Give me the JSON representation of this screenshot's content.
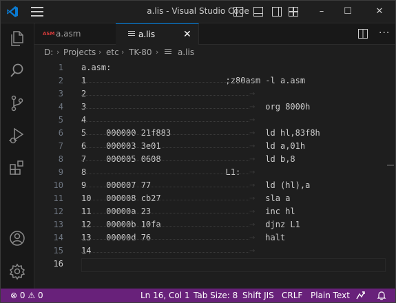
{
  "window": {
    "title": "a.lis - Visual Studio Code",
    "buttons": {
      "minimize": "–",
      "maximize": "☐",
      "close": "✕"
    }
  },
  "tabs": [
    {
      "badge": "ASM",
      "label": "a.asm",
      "active": false
    },
    {
      "label": "a.lis",
      "active": true,
      "close": "✕"
    }
  ],
  "tab_actions": {
    "more": "···"
  },
  "breadcrumb": [
    "D:",
    "Projects",
    "etc",
    "TK-80",
    "a.lis"
  ],
  "editor": {
    "lines": [
      {
        "n": "1",
        "text": "a.asm:"
      },
      {
        "n": "2",
        "text": "1                            ;z80asm -l a.asm"
      },
      {
        "n": "3",
        "text": "2"
      },
      {
        "n": "4",
        "text": "3                                    org 8000h"
      },
      {
        "n": "5",
        "text": "4"
      },
      {
        "n": "6",
        "text": "5    000000 21f883                   ld hl,83f8h"
      },
      {
        "n": "7",
        "text": "6    000003 3e01                     ld a,01h"
      },
      {
        "n": "8",
        "text": "7    000005 0608                     ld b,8"
      },
      {
        "n": "9",
        "text": "8                            L1:"
      },
      {
        "n": "10",
        "text": "9    000007 77                       ld (hl),a"
      },
      {
        "n": "11",
        "text": "10   000008 cb27                     sla a"
      },
      {
        "n": "12",
        "text": "11   00000a 23                       inc hl"
      },
      {
        "n": "13",
        "text": "12   00000b 10fa                     djnz L1"
      },
      {
        "n": "14",
        "text": "13   00000d 76                       halt"
      },
      {
        "n": "15",
        "text": "14"
      },
      {
        "n": "16",
        "text": ""
      }
    ],
    "active_line": "16"
  },
  "status": {
    "errors": "0",
    "warnings": "0",
    "position": "Ln 16, Col 1",
    "tab_size": "Tab Size: 8",
    "encoding": "Shift JIS",
    "eol": "CRLF",
    "language": "Plain Text"
  },
  "colors": {
    "statusbar": "#68217a",
    "accent": "#0078d4",
    "editor_bg": "#1e1e1e"
  }
}
